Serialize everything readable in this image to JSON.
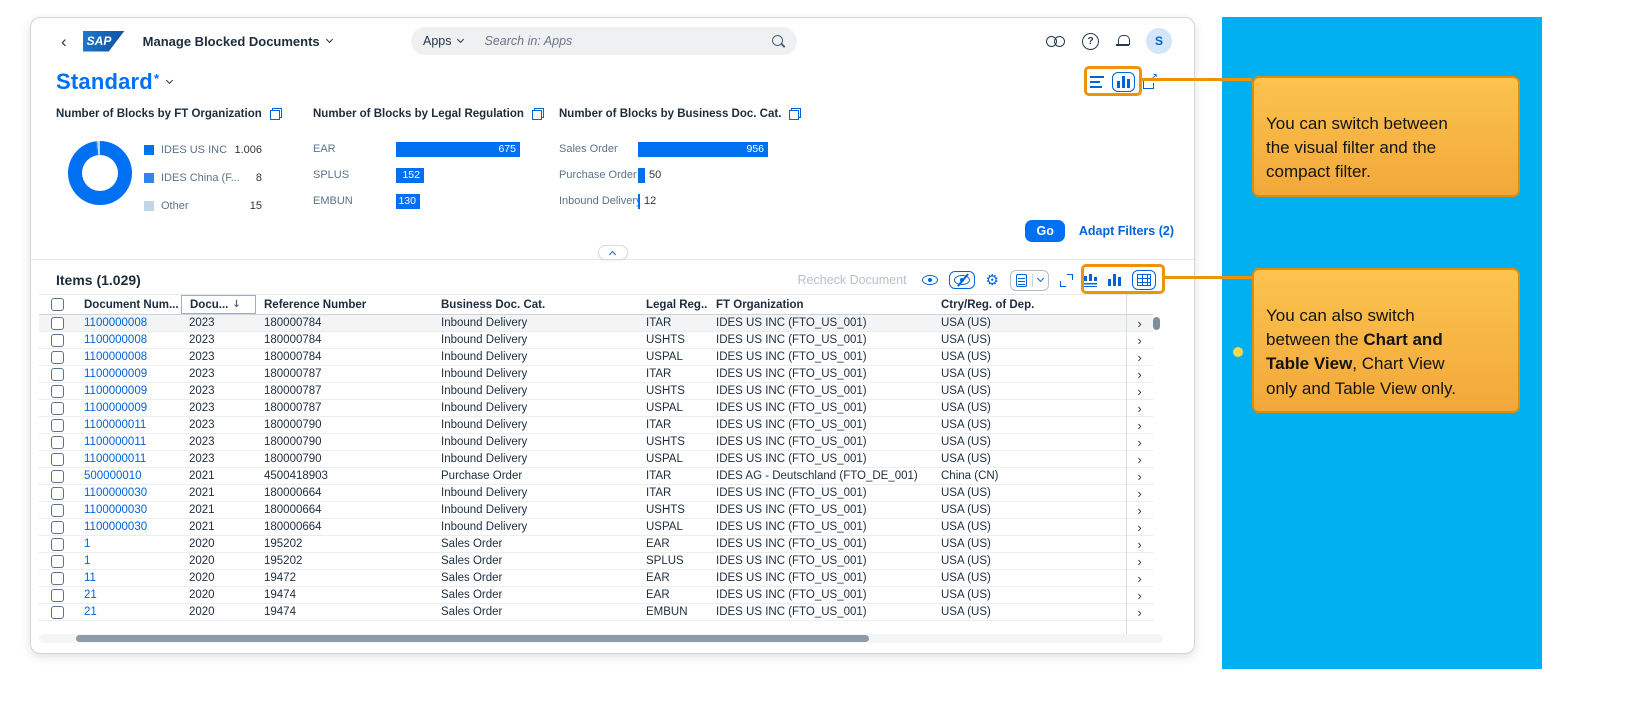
{
  "icons": {
    "back": "‹",
    "help": "?",
    "gear": "⚙",
    "sort_desc": "↓",
    "row_chevron": "›",
    "share_arrow": "↗"
  },
  "shell": {
    "logo_text": "SAP",
    "app_title": "Manage Blocked Documents",
    "apps_label": "Apps",
    "search_placeholder": "Search in: Apps",
    "avatar_initial": "S"
  },
  "variant": {
    "title": "Standard",
    "dirty_marker": "*"
  },
  "filters": {
    "go_label": "Go",
    "adapt_filters_label": "Adapt Filters (2)"
  },
  "chart_data": [
    {
      "type": "pie",
      "title": "Number of Blocks by FT Organization",
      "slices": [
        {
          "label": "IDES US INC (...",
          "value": 1006,
          "display": "1.006",
          "color": "#0070f2"
        },
        {
          "label": "IDES China (F...",
          "value": 8,
          "display": "8",
          "color": "#2e84f0"
        },
        {
          "label": "Other",
          "value": 15,
          "display": "15",
          "color": "#c2d6ea"
        }
      ]
    },
    {
      "type": "bar",
      "title": "Number of Blocks by Legal Regulation",
      "categories": [
        "EAR",
        "SPLUS",
        "EMBUN"
      ],
      "values": [
        675,
        152,
        130
      ],
      "max": 675,
      "bar_color": "#0070f2"
    },
    {
      "type": "bar",
      "title": "Number of Blocks by Business Doc. Cat.",
      "categories": [
        "Sales Order",
        "Purchase Order",
        "Inbound Delivery"
      ],
      "values": [
        956,
        50,
        12
      ],
      "max": 956,
      "bar_color": "#0070f2"
    }
  ],
  "items": {
    "title": "Items (1.029)",
    "recheck_label": "Recheck Document",
    "columns": [
      "Document Num...",
      "Docu...",
      "Reference Number",
      "Business Doc. Cat.",
      "Legal Reg...",
      "FT Organization",
      "Ctry/Reg. of Dep."
    ],
    "rows": [
      [
        "1100000008",
        "2023",
        "180000784",
        "Inbound Delivery",
        "ITAR",
        "IDES US INC (FTO_US_001)",
        "USA (US)"
      ],
      [
        "1100000008",
        "2023",
        "180000784",
        "Inbound Delivery",
        "USHTS",
        "IDES US INC (FTO_US_001)",
        "USA (US)"
      ],
      [
        "1100000008",
        "2023",
        "180000784",
        "Inbound Delivery",
        "USPAL",
        "IDES US INC (FTO_US_001)",
        "USA (US)"
      ],
      [
        "1100000009",
        "2023",
        "180000787",
        "Inbound Delivery",
        "ITAR",
        "IDES US INC (FTO_US_001)",
        "USA (US)"
      ],
      [
        "1100000009",
        "2023",
        "180000787",
        "Inbound Delivery",
        "USHTS",
        "IDES US INC (FTO_US_001)",
        "USA (US)"
      ],
      [
        "1100000009",
        "2023",
        "180000787",
        "Inbound Delivery",
        "USPAL",
        "IDES US INC (FTO_US_001)",
        "USA (US)"
      ],
      [
        "1100000011",
        "2023",
        "180000790",
        "Inbound Delivery",
        "ITAR",
        "IDES US INC (FTO_US_001)",
        "USA (US)"
      ],
      [
        "1100000011",
        "2023",
        "180000790",
        "Inbound Delivery",
        "USHTS",
        "IDES US INC (FTO_US_001)",
        "USA (US)"
      ],
      [
        "1100000011",
        "2023",
        "180000790",
        "Inbound Delivery",
        "USPAL",
        "IDES US INC (FTO_US_001)",
        "USA (US)"
      ],
      [
        "500000010",
        "2021",
        "4500418903",
        "Purchase Order",
        "ITAR",
        "IDES AG - Deutschland (FTO_DE_001)",
        "China (CN)"
      ],
      [
        "1100000030",
        "2021",
        "180000664",
        "Inbound Delivery",
        "ITAR",
        "IDES US INC (FTO_US_001)",
        "USA (US)"
      ],
      [
        "1100000030",
        "2021",
        "180000664",
        "Inbound Delivery",
        "USHTS",
        "IDES US INC (FTO_US_001)",
        "USA (US)"
      ],
      [
        "1100000030",
        "2021",
        "180000664",
        "Inbound Delivery",
        "USPAL",
        "IDES US INC (FTO_US_001)",
        "USA (US)"
      ],
      [
        "1",
        "2020",
        "195202",
        "Sales Order",
        "EAR",
        "IDES US INC (FTO_US_001)",
        "USA (US)"
      ],
      [
        "1",
        "2020",
        "195202",
        "Sales Order",
        "SPLUS",
        "IDES US INC (FTO_US_001)",
        "USA (US)"
      ],
      [
        "11",
        "2020",
        "19472",
        "Sales Order",
        "EAR",
        "IDES US INC (FTO_US_001)",
        "USA (US)"
      ],
      [
        "21",
        "2020",
        "19474",
        "Sales Order",
        "EAR",
        "IDES US INC (FTO_US_001)",
        "USA (US)"
      ],
      [
        "21",
        "2020",
        "19474",
        "Sales Order",
        "EMBUN",
        "IDES US INC (FTO_US_001)",
        "USA (US)"
      ]
    ]
  },
  "callouts": {
    "first": {
      "text": "You can switch between\nthe visual filter and the\ncompact filter."
    },
    "second": {
      "pre": "You can also switch\nbetween the ",
      "bold": "Chart and\nTable View",
      "post": ", Chart View\nonly and Table View only."
    }
  }
}
